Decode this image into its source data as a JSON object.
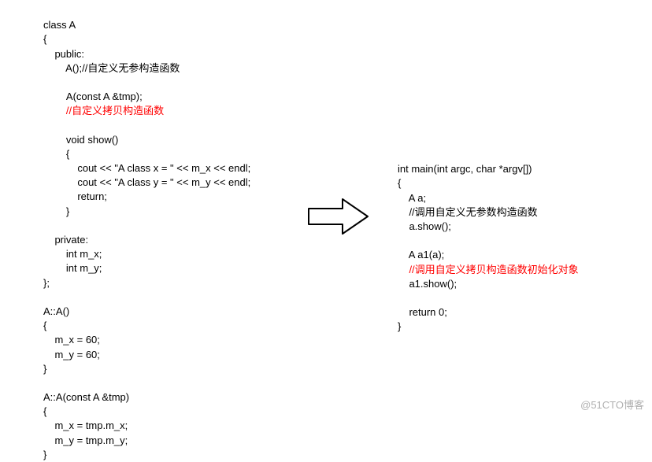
{
  "left": {
    "l1": "class A",
    "l2": "{",
    "l3": "    public:",
    "l4": "        A();//自定义无参构造函数",
    "l5": "",
    "l6": "        A(const A &tmp);",
    "l7": "        //自定义拷贝构造函数",
    "l8": "",
    "l9": "        void show()",
    "l10": "        {",
    "l11": "            cout << \"A class x = \" << m_x << endl;",
    "l12": "            cout << \"A class y = \" << m_y << endl;",
    "l13": "            return;",
    "l14": "        }",
    "l15": "",
    "l16": "    private:",
    "l17": "        int m_x;",
    "l18": "        int m_y;",
    "l19": "};",
    "l20": "",
    "l21": "A::A()",
    "l22": "{",
    "l23": "    m_x = 60;",
    "l24": "    m_y = 60;",
    "l25": "}",
    "l26": "",
    "l27": "A::A(const A &tmp)",
    "l28": "{",
    "l29": "    m_x = tmp.m_x;",
    "l30": "    m_y = tmp.m_y;",
    "l31": "}"
  },
  "right": {
    "r1": "int main(int argc, char *argv[])",
    "r2": "{",
    "r3": "    A a;",
    "r4": "    //调用自定义无参数构造函数",
    "r5": "    a.show();",
    "r6": "",
    "r7": "    A a1(a);",
    "r8": "    //调用自定义拷贝构造函数初始化对象",
    "r9": "    a1.show();",
    "r10": "",
    "r11": "    return 0;",
    "r12": "}"
  },
  "watermark": "@51CTO博客"
}
